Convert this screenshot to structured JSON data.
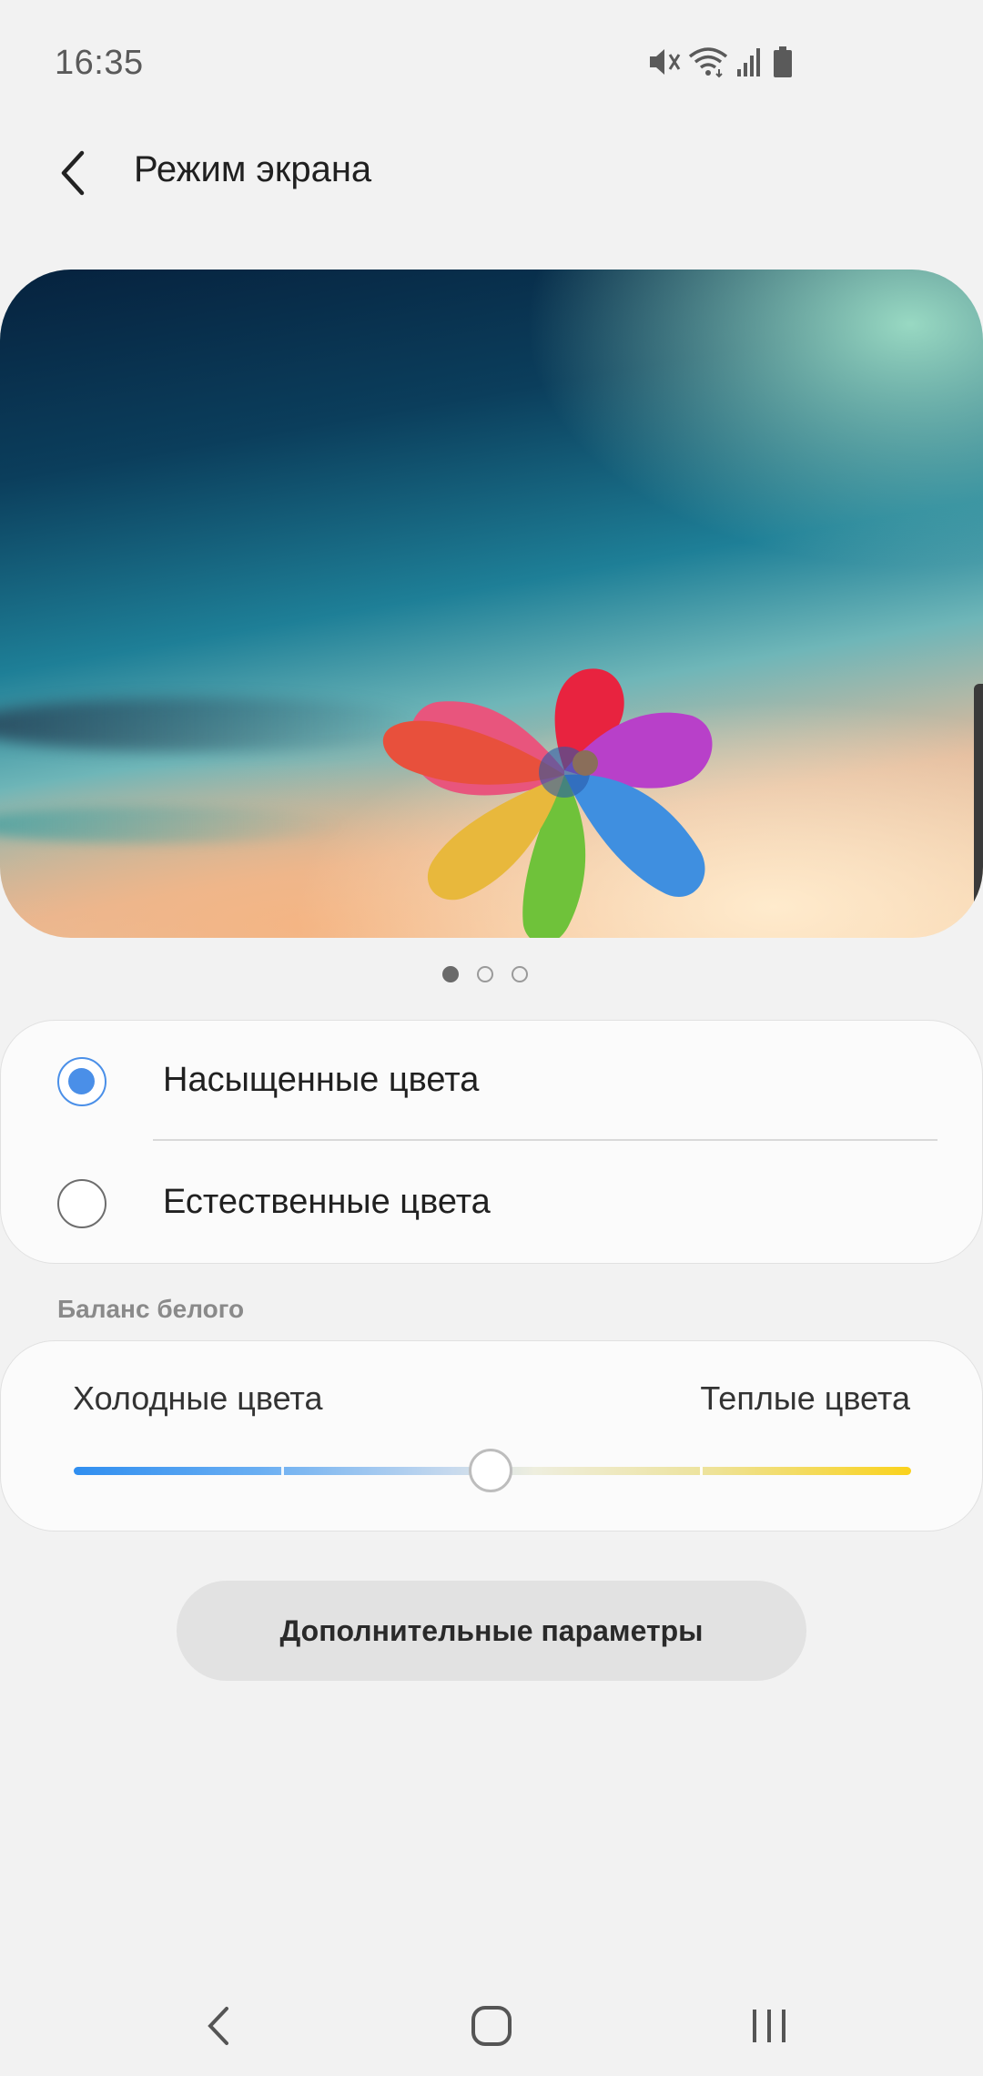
{
  "status_bar": {
    "time": "16:35",
    "icons": [
      "mute-icon",
      "wifi-icon",
      "signal-icon",
      "battery-icon"
    ]
  },
  "header": {
    "title": "Режим экрана",
    "back_icon": "back-arrow-icon"
  },
  "preview": {
    "pages": 3,
    "active_page": 1
  },
  "screen_modes": {
    "options": [
      {
        "label": "Насыщенные цвета",
        "selected": true
      },
      {
        "label": "Естественные цвета",
        "selected": false
      }
    ]
  },
  "white_balance": {
    "section_label": "Баланс белого",
    "cold_label": "Холодные цвета",
    "warm_label": "Теплые цвета",
    "value_fraction": 0.5
  },
  "more_button": {
    "label": "Дополнительные параметры"
  },
  "nav_bar": {
    "buttons": [
      "back-icon",
      "home-icon",
      "recents-icon"
    ]
  },
  "colors": {
    "accent": "#4a8fe8",
    "background": "#f2f2f2",
    "card": "#fbfbfb"
  }
}
